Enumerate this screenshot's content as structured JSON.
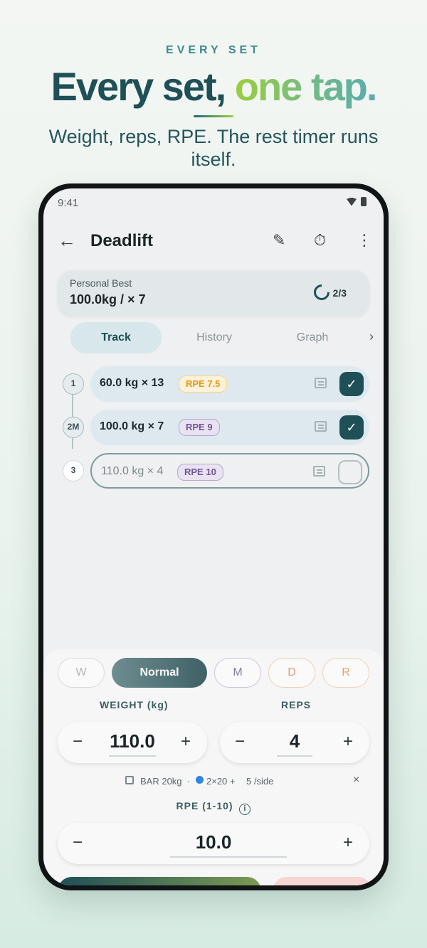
{
  "marketing": {
    "eyebrow": "EVERY SET",
    "headline_part1": "Every set,",
    "headline_part2": "one tap.",
    "subhead": "Weight, reps, RPE. The rest timer runs itself."
  },
  "status_bar": {
    "time": "9:41"
  },
  "app_bar": {
    "title": "Deadlift",
    "icons": [
      "back-arrow-icon",
      "edit-icon",
      "timer-icon",
      "more-vert-icon"
    ]
  },
  "personal_best": {
    "label": "Personal Best",
    "value": "100.0kg / × 7",
    "progress": "2/3"
  },
  "tabs": [
    "Track",
    "History",
    "Graph"
  ],
  "sets": [
    {
      "index": "1",
      "weight": "60.0",
      "unit": "kg ×",
      "reps": "13",
      "rpe": "RPE 7.5",
      "done": true
    },
    {
      "index": "2M",
      "weight": "100.0",
      "unit": "kg ×",
      "reps": "7",
      "rpe": "RPE 9",
      "done": true
    },
    {
      "index": "3",
      "weight": "110.0",
      "unit": "kg ×",
      "reps": "4",
      "rpe": "RPE 10",
      "done": false
    }
  ],
  "set_types": [
    "W",
    "Normal",
    "M",
    "D",
    "R"
  ],
  "weight": {
    "label": "WEIGHT (kg)",
    "value": "110.0",
    "minus": "−",
    "plus": "+"
  },
  "reps": {
    "label": "REPS",
    "value": "4",
    "minus": "−",
    "plus": "+"
  },
  "plates": {
    "bar": "BAR 20kg",
    "sep": "·",
    "plates": "2×20 +",
    "side": "5 /side",
    "close": "×"
  },
  "rpe_input": {
    "label": "RPE (1-10)",
    "info": "i",
    "value": "10.0",
    "minus": "−",
    "plus": "+"
  },
  "colors": {
    "primary": "#1f4f57",
    "accent_green": "#9bcf3f",
    "rpe_orange": "#e29a12",
    "rpe_purple": "#6f5593"
  }
}
